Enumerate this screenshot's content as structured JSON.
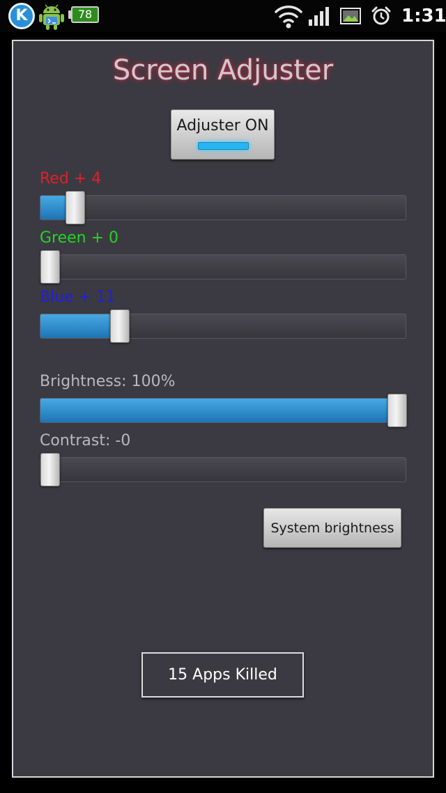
{
  "status_bar": {
    "k_app_letter": "K",
    "battery": "78",
    "time": "1:31",
    "icons": [
      "k-app-icon",
      "android-debug-icon",
      "battery-icon",
      "wifi-icon",
      "signal-icon",
      "image-icon",
      "alarm-icon"
    ]
  },
  "app": {
    "title": "Screen Adjuster",
    "title_glow_color": "#d2283c",
    "toggle": {
      "label": "Adjuster ON",
      "state": true,
      "indicator_color": "#27b6f2"
    },
    "sliders": [
      {
        "id": "red",
        "label": "Red + 4",
        "color": "#e0202a",
        "value": 4,
        "max": 55
      },
      {
        "id": "green",
        "label": "Green + 0",
        "color": "#22d622",
        "value": 0,
        "max": 55
      },
      {
        "id": "blue",
        "label": "Blue + 11",
        "color": "#2020d8",
        "value": 11,
        "max": 55
      },
      {
        "id": "brightness",
        "label": "Brightness: 100%",
        "color": "#b8b8c0",
        "value": 100,
        "max": 100
      },
      {
        "id": "contrast",
        "label": "Contrast: -0",
        "color": "#b8b8c0",
        "value": 0,
        "max": 100
      }
    ],
    "system_brightness_button": "System brightness",
    "apps_killed_button": "15 Apps Killed",
    "accent_color": "#2a8fd0"
  }
}
